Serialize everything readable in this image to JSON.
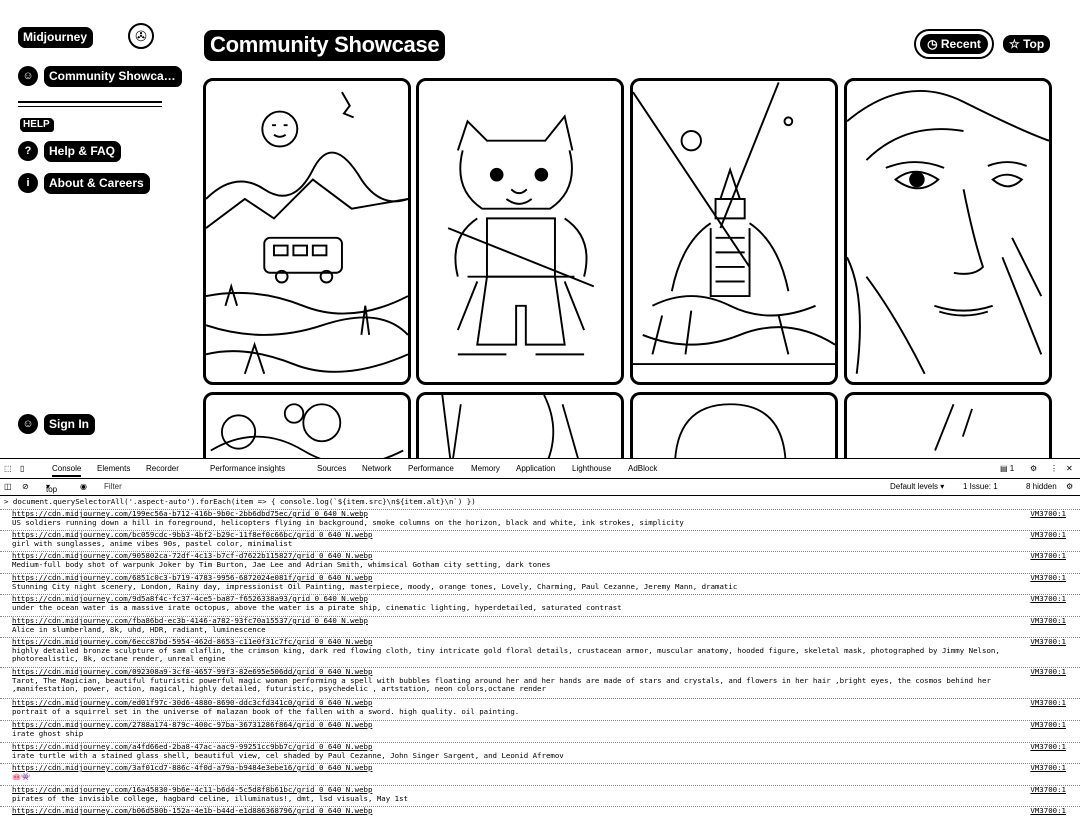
{
  "sidebar": {
    "logo": "Midjourney",
    "nav_community": "Community Showca…",
    "help_tag": "HELP",
    "help_faq": "Help & FAQ",
    "about": "About & Careers",
    "sign_in": "Sign In"
  },
  "header": {
    "title": "Community Showcase",
    "tab_recent": "Recent",
    "tab_top": "Top"
  },
  "devtools": {
    "tabs": [
      "Console",
      "Elements",
      "Recorder",
      "Performance insights",
      "Sources",
      "Network",
      "Performance",
      "Memory",
      "Application",
      "Lighthouse",
      "AdBlock"
    ],
    "issues_badge": "1",
    "context": "top",
    "filter_placeholder": "Filter",
    "levels": "Default levels ▾",
    "issue_count": "1 Issue: 1",
    "hidden": "8 hidden",
    "command": "document.querySelectorAll('.aspect-auto').forEach(item => { console.log(`${item.src}\\n${item.alt}\\n`) })",
    "logs": [
      {
        "src": "https://cdn.midjourney.com/199ec56a-b712-416b-9b0c-2bb6dbd75ec/grid_0_640_N.webp",
        "alt": "US soldiers running down a hill in foreground, helicopters flying in background, smoke columns on the horizon, black and white, ink strokes, simplicity",
        "vm": "VM3700:1"
      },
      {
        "src": "https://cdn.midjourney.com/bc059cdc-9bb3-4bf2-b29c-11f8ef0c66bc/grid_0_640_N.webp",
        "alt": "girl with sunglasses, anime vibes 90s, pastel color, minimalist",
        "vm": "VM3700:1"
      },
      {
        "src": "https://cdn.midjourney.com/905802ca-72df-4c13-b7cf-d7622b115827/grid_0_640_N.webp",
        "alt": "Medium-full body shot of warpunk Joker by Tim Burton, Jae Lee and Adrian Smith, whimsical Gotham city setting, dark tones",
        "vm": "VM3700:1"
      },
      {
        "src": "https://cdn.midjourney.com/6851c0c3-b719-4783-9956-6872024e081f/grid_0_640_N.webp",
        "alt": "Stunning City night scenery, London, Rainy day, impressionist Oil Painting, masterpiece, moody, orange tones, Lovely, Charming, Paul Cezanne, Jeremy Mann, dramatic",
        "vm": "VM3700:1"
      },
      {
        "src": "https://cdn.midjourney.com/9d5a8f4c-fc37-4ce5-ba87-f6526338a93/grid_0_640_N.webp",
        "alt": "under the ocean water is a massive irate octopus, above the water is a pirate ship, cinematic lighting, hyperdetailed, saturated contrast",
        "vm": "VM3700:1"
      },
      {
        "src": "https://cdn.midjourney.com/fba86bd-ec3b-4146-a782-93fc70a15537/grid_0_640_N.webp",
        "alt": "Alice in slumberland, 8k, uhd, HDR, radiant, luminescence",
        "vm": "VM3700:1"
      },
      {
        "src": "https://cdn.midjourney.com/6ecc87bd-5954-462d-8653-c11e0f31c7fc/grid_0_640_N.webp",
        "alt": "highly detailed bronze sculpture of sam claflin, the crimson king, dark red flowing cloth, tiny intricate gold floral details, crustacean armor, muscular anatomy, hooded figure, skeletal mask, photographed by Jimmy Nelson, photorealistic, 8k, octane render, unreal engine",
        "vm": "VM3700:1"
      },
      {
        "src": "https://cdn.midjourney.com/092308a9-3cf8-4657-99f3-82e695e506dd/grid_0_640_N.webp",
        "alt": "Tarot, The Magician, beautiful futuristic powerful magic woman performing a spell with bubbles floating around her and her hands are made of stars and crystals, and flowers in her hair ,bright eyes, the cosmos behind her ,manifestation, power, action, magical, highly detailed, futuristic, psychedelic , artstation, neon colors,octane render",
        "vm": "VM3700:1"
      },
      {
        "src": "https://cdn.midjourney.com/ed01f97c-30d6-4880-8690-ddc3cfd341c0/grid_0_640_N.webp",
        "alt": "portrait of a squirrel set in the universe of malazan book of the fallen with a sword. high quality. oil painting.",
        "vm": "VM3700:1"
      },
      {
        "src": "https://cdn.midjourney.com/2788a174-879c-400c-97ba-36731286f864/grid_0_640_N.webp",
        "alt": "irate ghost ship",
        "vm": "VM3700:1"
      },
      {
        "src": "https://cdn.midjourney.com/a4fd66ed-2ba8-47ac-aac9-99251cc9bb7c/grid_0_640_N.webp",
        "alt": "irate turtle with a stained glass shell, beautiful view, cel shaded by Paul Cezanne, John Singer Sargent, and Leonid Afremov",
        "vm": "VM3700:1"
      },
      {
        "src": "https://cdn.midjourney.com/3af01cd7-886c-4f0d-a79a-b9484e3ebe16/grid_0_640_N.webp",
        "alt": "🐽👾",
        "vm": "VM3700:1"
      },
      {
        "src": "https://cdn.midjourney.com/16a45830-9b6e-4c11-b6d4-5c5d8f8b61bc/grid_0_640_N.webp",
        "alt": "pirates of the invisible college, hagbard celine, illuminatus!, dmt, lsd visuals, May 1st",
        "vm": "VM3700:1"
      },
      {
        "src": "https://cdn.midjourney.com/b06d580b-152a-4e1b-b44d-e1d886368796/grid_0_640_N.webp",
        "alt": "",
        "vm": "VM3700:1"
      }
    ]
  }
}
